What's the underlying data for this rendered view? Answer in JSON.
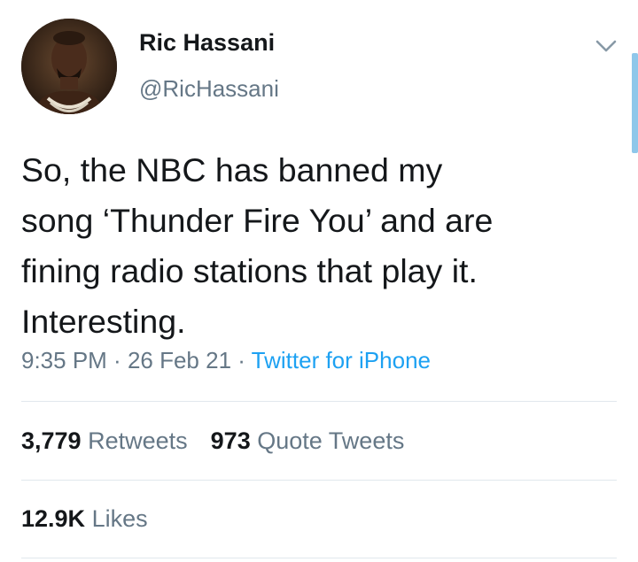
{
  "user": {
    "display_name": "Ric Hassani",
    "handle": "@RicHassani",
    "avatar_icon": "profile-photo"
  },
  "tweet": {
    "text_lines": [
      "So, the NBC has banned my",
      "song ‘Thunder Fire You’ and are",
      "fining radio stations that play it.",
      "Interesting."
    ],
    "time": "9:35 PM",
    "separator": " · ",
    "date": "26 Feb 21",
    "source": "Twitter for iPhone"
  },
  "stats": {
    "retweets_count": "3,779",
    "retweets_label": "Retweets",
    "quote_count": "973",
    "quote_label": "Quote Tweets",
    "likes_count": "12.9K",
    "likes_label": "Likes"
  },
  "colors": {
    "text_primary": "#14171a",
    "text_secondary": "#657786",
    "link": "#1da1f2",
    "divider": "#e1e8ed"
  },
  "icons": {
    "menu": "chevron-down-icon"
  }
}
